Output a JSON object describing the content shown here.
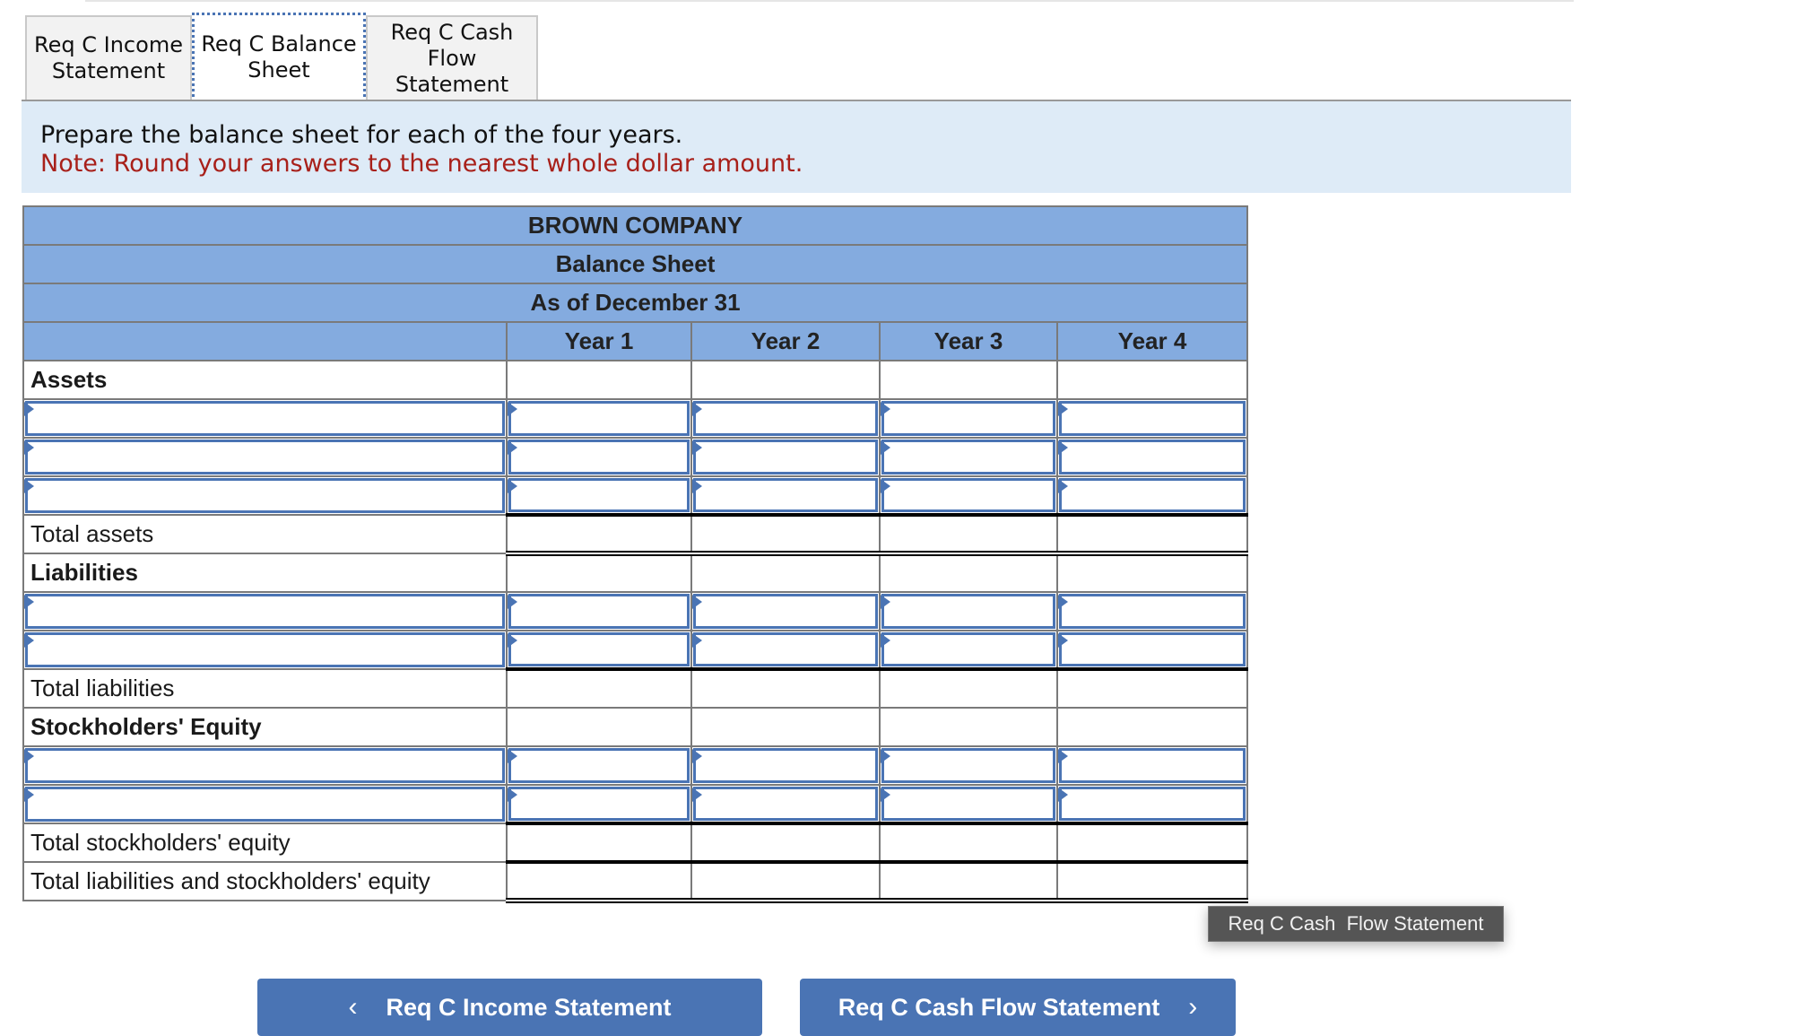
{
  "tabs": [
    {
      "label": "Req C Income Statement",
      "active": false
    },
    {
      "label": "Req C Balance Sheet",
      "active": true
    },
    {
      "label": "Req C Cash Flow Statement",
      "active": false
    }
  ],
  "instructions": {
    "text": "Prepare the balance sheet for each of the four years.",
    "note": "Note: Round your answers to the nearest whole dollar amount."
  },
  "statement": {
    "company": "BROWN COMPANY",
    "title": "Balance Sheet",
    "date": "As of December 31",
    "columns": [
      "Year  1",
      "Year  2",
      "Year  3",
      "Year  4"
    ],
    "sections": {
      "assets_header": "Assets",
      "total_assets": "Total assets",
      "liabilities_header": "Liabilities",
      "total_liabilities": "Total liabilities",
      "equity_header": "Stockholders' Equity",
      "total_equity": "Total stockholders' equity",
      "total_liab_equity": "Total liabilities and stockholders' equity"
    }
  },
  "tooltip": "Req C Cash  Flow Statement",
  "nav": {
    "prev_label": "Req C Income Statement",
    "next_label": "Req C Cash Flow Statement",
    "prev_icon": "‹",
    "next_icon": "›"
  },
  "colors": {
    "header_bg": "#84abdf",
    "accent": "#4a74b4",
    "note": "#a8201a",
    "panel_bg": "#deebf7"
  }
}
